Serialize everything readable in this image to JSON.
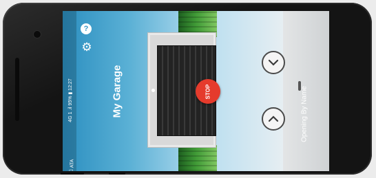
{
  "app": {
    "title": "My Garage",
    "status_bar": "4G 1 .il 95% ▮ 12:27",
    "carrier": "ATA"
  },
  "controls": {
    "stop_label": "STOP",
    "door_status": "Opening By Name"
  },
  "icons": {
    "settings": "gear-icon",
    "help": "help-icon",
    "open": "chevron-up-icon",
    "close": "chevron-down-icon"
  },
  "colors": {
    "stop": "#e53b2c",
    "sky": "#2c8fc0"
  }
}
